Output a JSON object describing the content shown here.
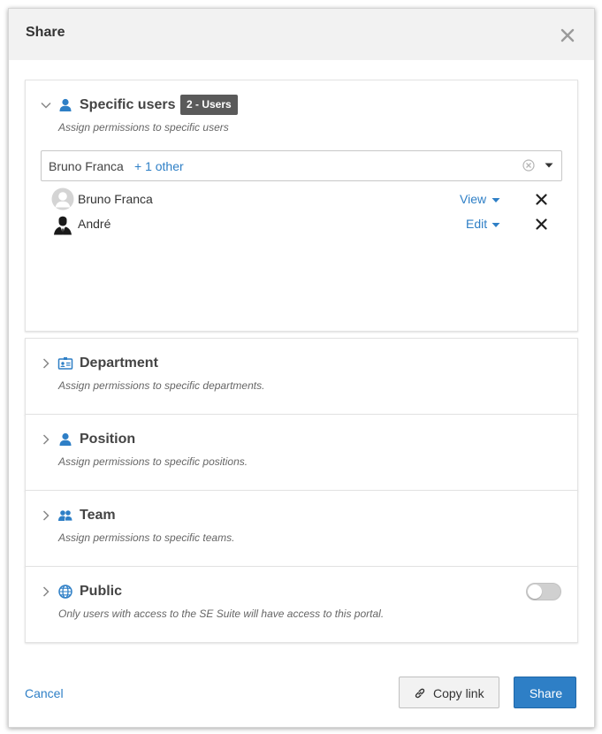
{
  "dialog": {
    "title": "Share",
    "close_icon": "close-icon"
  },
  "colors": {
    "accent": "#2e7fc6",
    "badge_bg": "#5a5a5a",
    "header_bg": "#f2f2f2",
    "icon_blue": "#2e7fc6"
  },
  "specific_users": {
    "title": "Specific users",
    "badge": "2 - Users",
    "description": "Assign permissions to specific users",
    "select": {
      "value": "Bruno Franca",
      "more": "+ 1 other"
    },
    "users": [
      {
        "name": "Bruno Franca",
        "permission": "View",
        "avatar": "default-avatar-icon"
      },
      {
        "name": "André",
        "permission": "Edit",
        "avatar": "businessman-avatar-icon"
      }
    ]
  },
  "department": {
    "title": "Department",
    "description": "Assign permissions to specific departments."
  },
  "position": {
    "title": "Position",
    "description": "Assign permissions to specific positions."
  },
  "team": {
    "title": "Team",
    "description": "Assign permissions to specific teams."
  },
  "public": {
    "title": "Public",
    "description": "Only users with access to the SE Suite will have access to this portal.",
    "toggle_on": false
  },
  "footer": {
    "cancel": "Cancel",
    "copy_link": "Copy link",
    "share": "Share"
  }
}
